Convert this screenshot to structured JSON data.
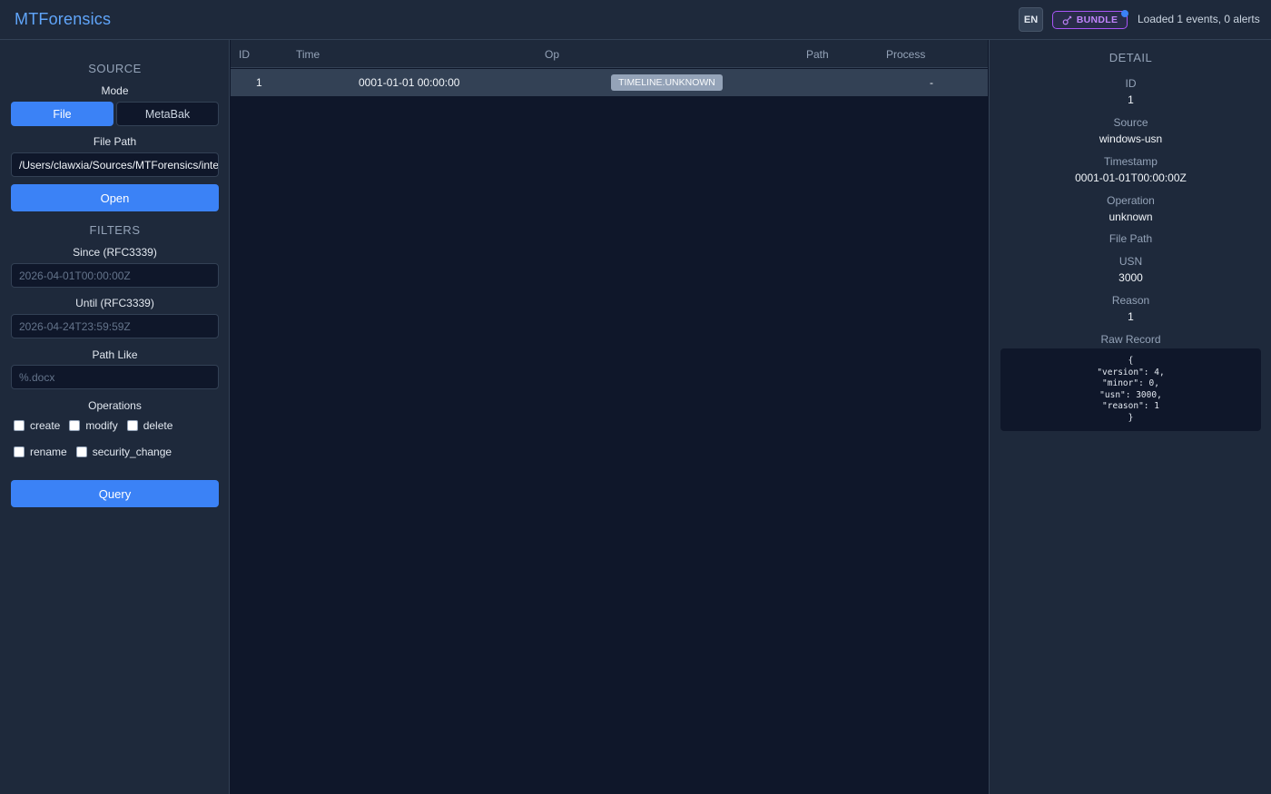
{
  "header": {
    "title": "MTForensics",
    "lang": "EN",
    "bundle_label": "BUNDLE",
    "status": "Loaded 1 events, 0 alerts"
  },
  "sidebar": {
    "source_title": "SOURCE",
    "mode_label": "Mode",
    "mode_options": [
      "File",
      "MetaBak"
    ],
    "mode_selected": "File",
    "file_path_label": "File Path",
    "file_path_value": "/Users/clawxia/Sources/MTForensics/inte",
    "open_label": "Open",
    "filters_title": "FILTERS",
    "since_label": "Since (RFC3339)",
    "since_placeholder": "2026-04-01T00:00:00Z",
    "until_label": "Until (RFC3339)",
    "until_placeholder": "2026-04-24T23:59:59Z",
    "path_like_label": "Path Like",
    "path_like_placeholder": "%.docx",
    "operations_label": "Operations",
    "operations": [
      "create",
      "modify",
      "delete",
      "rename",
      "security_change"
    ],
    "query_label": "Query"
  },
  "table": {
    "columns": [
      "ID",
      "Time",
      "Op",
      "Path",
      "Process"
    ],
    "rows": [
      {
        "id": "1",
        "time": "0001-01-01 00:00:00",
        "op": "TIMELINE.UNKNOWN",
        "path": "",
        "process": "-"
      }
    ]
  },
  "detail": {
    "title": "DETAIL",
    "fields": [
      {
        "label": "ID",
        "value": "1"
      },
      {
        "label": "Source",
        "value": "windows-usn"
      },
      {
        "label": "Timestamp",
        "value": "0001-01-01T00:00:00Z"
      },
      {
        "label": "Operation",
        "value": "unknown"
      },
      {
        "label": "File Path",
        "value": ""
      },
      {
        "label": "USN",
        "value": "3000"
      },
      {
        "label": "Reason",
        "value": "1"
      }
    ],
    "raw_label": "Raw Record",
    "raw_record": "{\n\"version\": 4,\n\"minor\": 0,\n\"usn\": 3000,\n\"reason\": 1\n}"
  },
  "colors": {
    "accent": "#3b82f6",
    "bundle": "#a855f7",
    "title": "#60a5fa"
  }
}
